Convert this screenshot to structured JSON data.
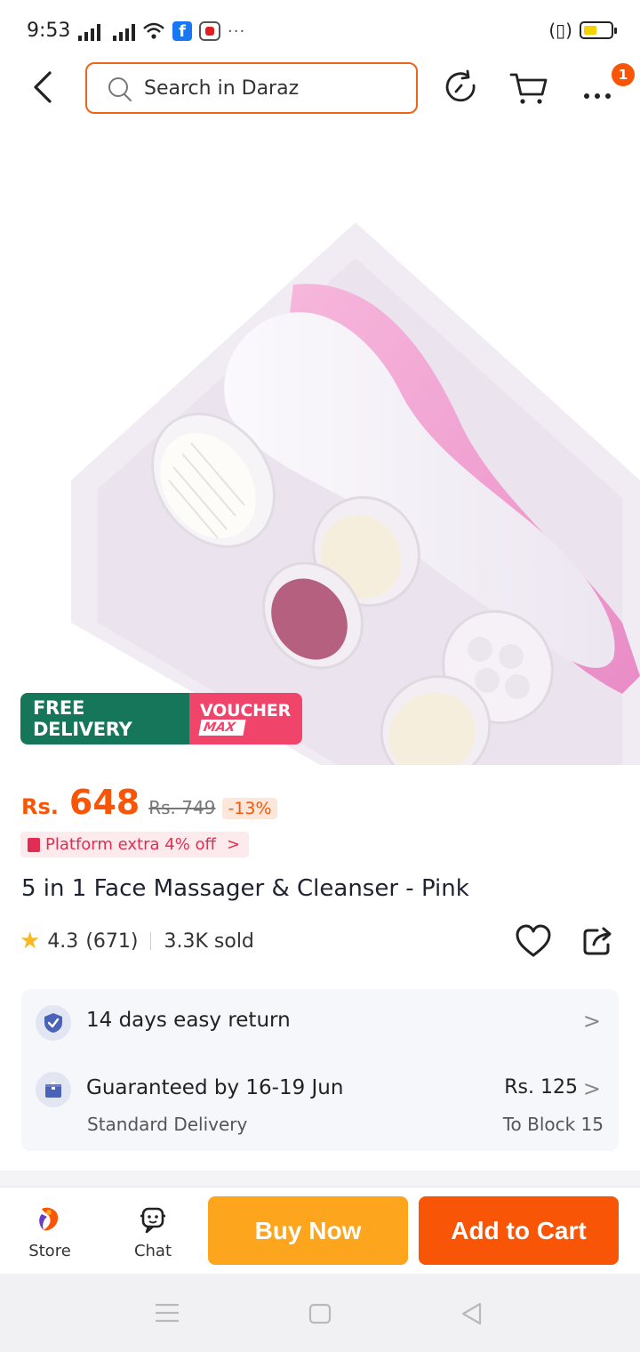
{
  "status_bar": {
    "time": "9:53",
    "more": "···"
  },
  "search": {
    "placeholder": "Search in Daraz"
  },
  "cart_badge": "1",
  "promo": {
    "free_delivery": "FREE DELIVERY",
    "voucher": "VOUCHER",
    "voucher_max": "MAX"
  },
  "price": {
    "currency": "Rs.",
    "current": "648",
    "original": "Rs. 749",
    "discount": "-13%",
    "platform_extra": "Platform extra 4% off",
    "platform_chevron": ">"
  },
  "product": {
    "title": "5 in 1 Face Massager & Cleanser - Pink",
    "rating": "4.3",
    "reviews": "(671)",
    "sold": "3.3K sold"
  },
  "services": {
    "return": "14 days easy return",
    "guaranteed": "Guaranteed by 16-19 Jun",
    "delivery_type": "Standard Delivery",
    "delivery_fee": "Rs. 125",
    "delivery_to": "To Block 15",
    "chevron": ">"
  },
  "bottom_bar": {
    "store": "Store",
    "chat": "Chat",
    "buy_now": "Buy Now",
    "add_to_cart": "Add to Cart"
  },
  "colors": {
    "brand_orange": "#f85606",
    "buy_now_yellow": "#fca51d",
    "free_delivery_green": "#16765a",
    "voucher_pink": "#f1446a"
  }
}
